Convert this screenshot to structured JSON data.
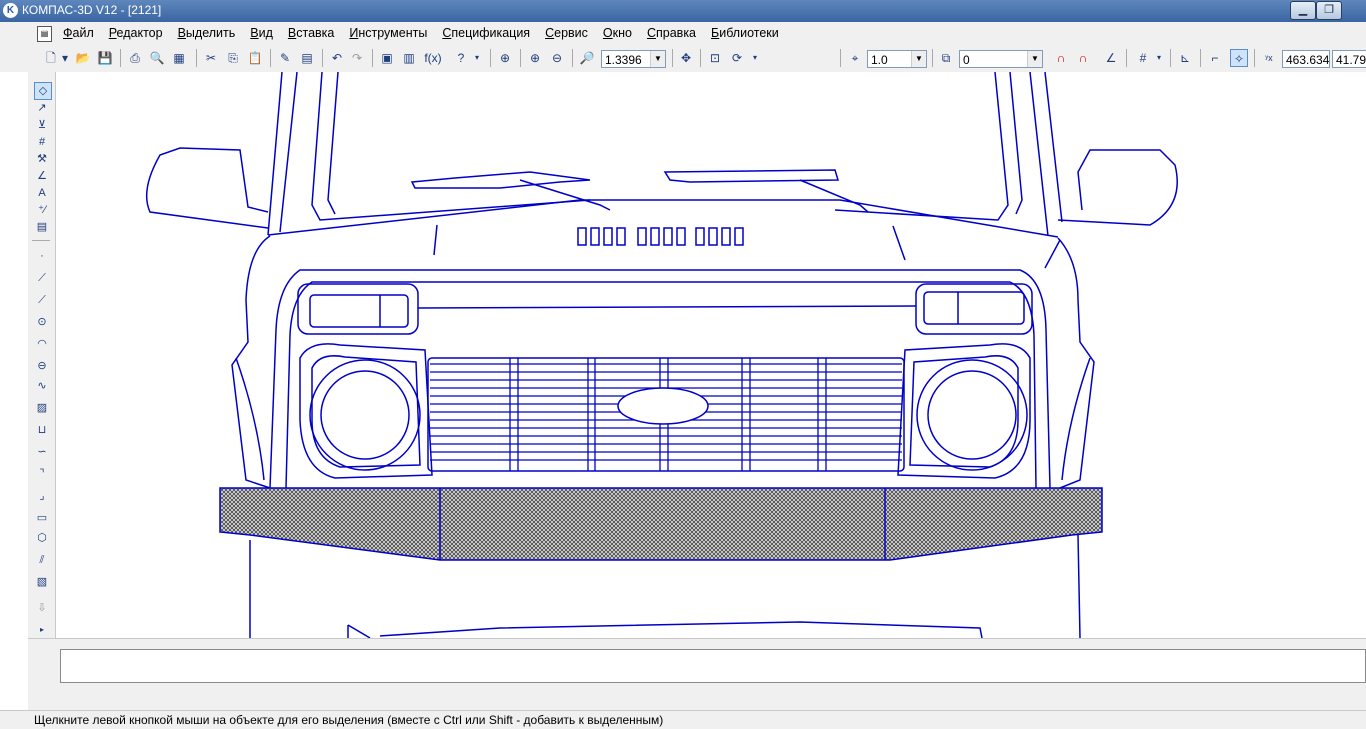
{
  "window": {
    "title": "КОМПАС-3D V12 - [2121]",
    "app_icon": "kompas-logo",
    "controls": [
      "minimize-icon",
      "restore-icon"
    ]
  },
  "menu": {
    "items": [
      "Файл",
      "Редактор",
      "Выделить",
      "Вид",
      "Вставка",
      "Инструменты",
      "Спецификация",
      "Сервис",
      "Окно",
      "Справка",
      "Библиотеки"
    ]
  },
  "toolbar": {
    "zoom_value": "1.3396",
    "step_value": "1.0",
    "layer_value": "0",
    "coord_x": "463.634",
    "coord_y": "41.79"
  },
  "status": {
    "hint": "Щелкните левой кнопкой мыши на объекте для его выделения (вместе с Ctrl или Shift - добавить к выделенным)"
  },
  "colors": {
    "drawing_line": "#0000c8",
    "title_bar": "#4a74ae",
    "panel": "#f0f0f0"
  }
}
